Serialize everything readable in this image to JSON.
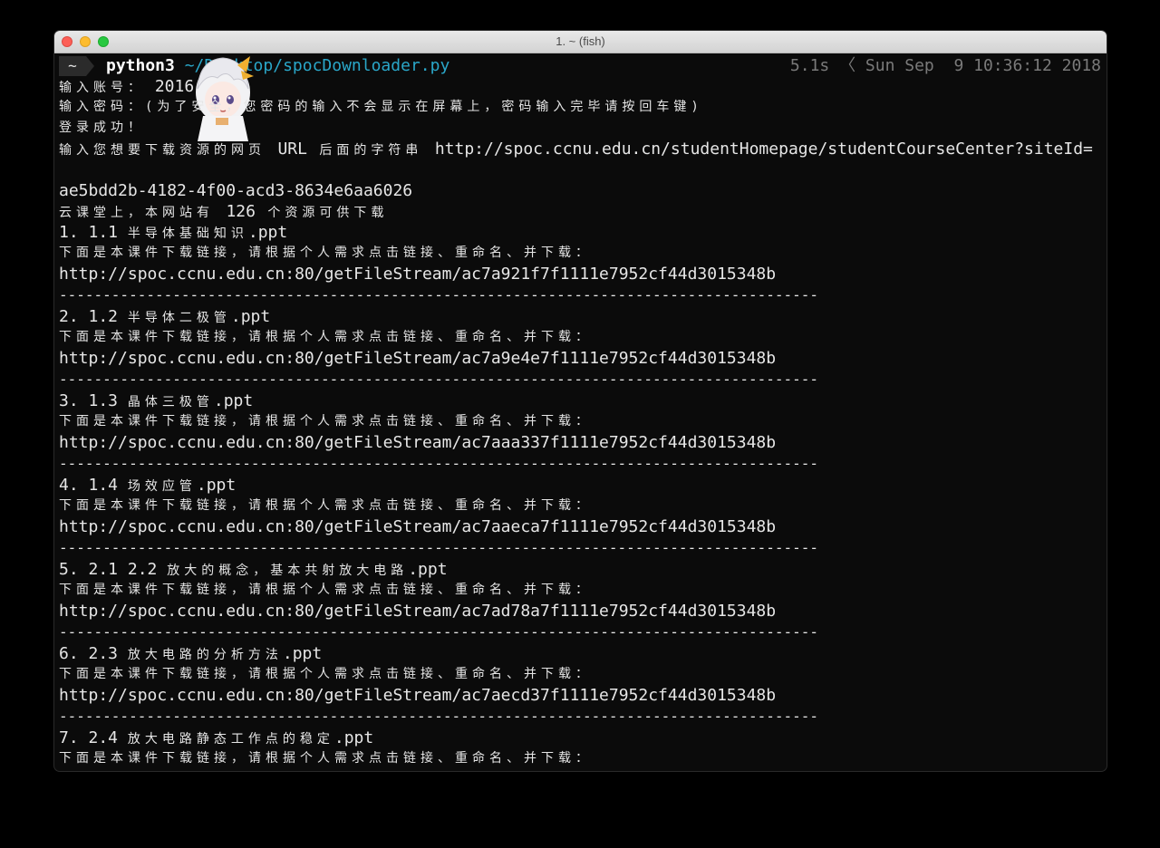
{
  "window": {
    "title": "1. ~ (fish)"
  },
  "prompt": {
    "badge": "~",
    "command": "python3",
    "path": " ~/Desktop/spocDownloader.py",
    "right": "5.1s 〈 Sun Sep  9 10:36:12 2018"
  },
  "lines": [
    {
      "text": "输入账号：",
      "rest": " 2016"
    },
    {
      "text": "输入密码：(为了安全，您密码的输入不会显示在屏幕上，密码输入完毕请按回车键)"
    },
    {
      "text": "登录成功！"
    },
    {
      "text": "输入您想要下载资源的网页 ",
      "rest": "URL",
      "text2": " 后面的字符串 ",
      "rest2": "http://spoc.ccnu.edu.cn/studentHomepage/studentCourseCenter?siteId="
    },
    {
      "text": "",
      "rest": "ae5bdd2b-4182-4f00-acd3-8634e6aa6026"
    },
    {
      "text": "云课堂上，本网站有 ",
      "rest": "126",
      "text2": " 个资源可供下载"
    }
  ],
  "entries": [
    {
      "num": "1. 1.1 ",
      "name": "半导体基础知识",
      "ext": ".ppt",
      "url": "http://spoc.ccnu.edu.cn:80/getFileStream/ac7a921f7f1111e7952cf44d3015348b"
    },
    {
      "num": "2. 1.2 ",
      "name": "半导体二极管",
      "ext": ".ppt",
      "url": "http://spoc.ccnu.edu.cn:80/getFileStream/ac7a9e4e7f1111e7952cf44d3015348b"
    },
    {
      "num": "3. 1.3 ",
      "name": "晶体三极管",
      "ext": ".ppt",
      "url": "http://spoc.ccnu.edu.cn:80/getFileStream/ac7aaa337f1111e7952cf44d3015348b"
    },
    {
      "num": "4. 1.4 ",
      "name": "场效应管",
      "ext": ".ppt",
      "url": "http://spoc.ccnu.edu.cn:80/getFileStream/ac7aaeca7f1111e7952cf44d3015348b"
    },
    {
      "num": "5. 2.1 2.2 ",
      "name": "放大的概念，基本共射放大电路",
      "ext": ".ppt",
      "url": "http://spoc.ccnu.edu.cn:80/getFileStream/ac7ad78a7f1111e7952cf44d3015348b"
    },
    {
      "num": "6. 2.3 ",
      "name": "放大电路的分析方法",
      "ext": ".ppt",
      "url": "http://spoc.ccnu.edu.cn:80/getFileStream/ac7aecd37f1111e7952cf44d3015348b"
    },
    {
      "num": "7. 2.4 ",
      "name": "放大电路静态工作点的稳定",
      "ext": ".ppt"
    }
  ],
  "download_hint": "下面是本课件下载链接，请根据个人需求点击链接、重命名、并下载：",
  "separator": "---------------------------------------------------------------------------------------",
  "colors": {
    "path": "#2aa7c9",
    "background": "#0b0b0b",
    "text": "#e6e6e6"
  },
  "avatar_icon": "anime-avatar-icon"
}
